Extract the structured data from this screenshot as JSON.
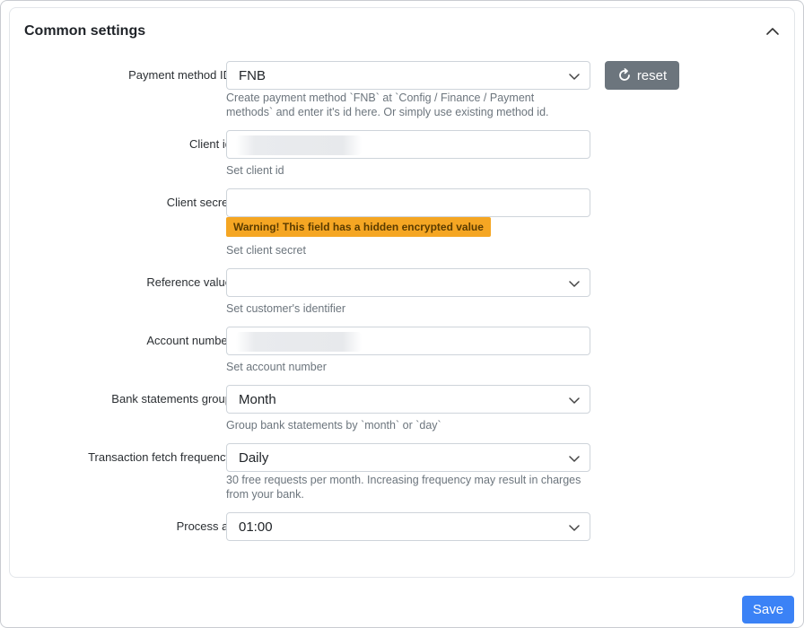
{
  "card": {
    "title": "Common settings"
  },
  "fields": {
    "payment_method": {
      "label": "Payment method ID",
      "value": "FNB",
      "help": "Create payment method `FNB` at `Config / Finance / Payment methods` and enter it's id here. Or simply use existing method id.",
      "reset_label": "reset"
    },
    "client_id": {
      "label": "Client id",
      "value": "",
      "help": "Set client id"
    },
    "client_secret": {
      "label": "Client secret",
      "value": "",
      "warning": "Warning! This field has a hidden encrypted value",
      "help": "Set client secret"
    },
    "reference_value": {
      "label": "Reference value",
      "value": "",
      "help": "Set customer's identifier"
    },
    "account_number": {
      "label": "Account number",
      "value": "",
      "help": "Set account number"
    },
    "bank_statements_group": {
      "label": "Bank statements group",
      "value": "Month",
      "help": "Group bank statements by `month` or `day`"
    },
    "fetch_frequency": {
      "label": "Transaction fetch frequency",
      "value": "Daily",
      "help": "30 free requests per month. Increasing frequency may result in charges from your bank."
    },
    "process_at": {
      "label": "Process at",
      "value": "01:00"
    }
  },
  "footer": {
    "save_label": "Save"
  },
  "colors": {
    "primary": "#3b82f6",
    "secondary": "#6c757d",
    "warning": "#f5a623"
  }
}
